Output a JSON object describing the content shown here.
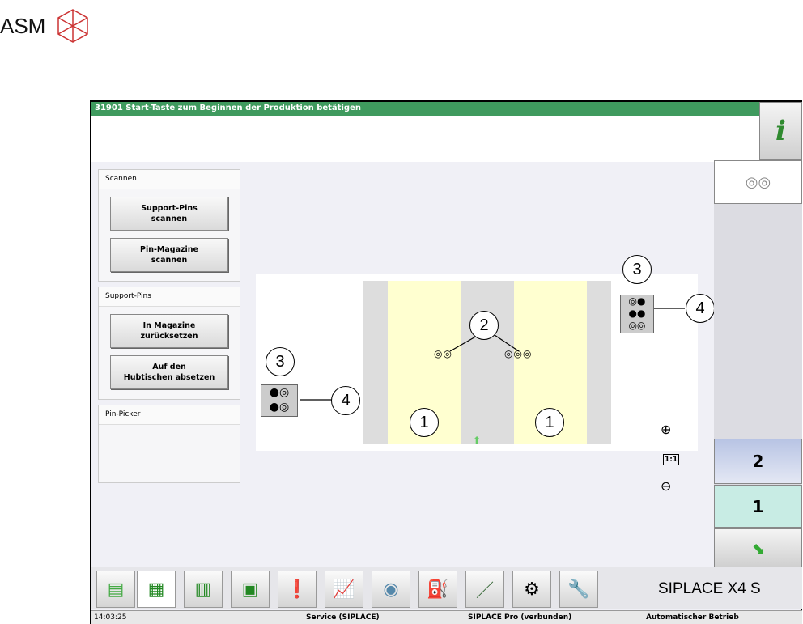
{
  "logo": {
    "text": "ASM"
  },
  "title": "31901 Start-Taste zum Beginnen der Produktion betätigen",
  "info_button": {
    "icon": "info-icon",
    "label": "i"
  },
  "groups": [
    {
      "header": "Scannen",
      "buttons": [
        "Support-Pins\nscannen",
        "Pin-Magazine\nscannen"
      ]
    },
    {
      "header": "Support-Pins",
      "buttons": [
        "In Magazine\nzurücksetzen",
        "Auf den\nHubtischen absetzen"
      ]
    },
    {
      "header": "Pin-Picker",
      "buttons": []
    }
  ],
  "callouts": {
    "lane": "1",
    "pins": "2",
    "magazine": "3",
    "pin_slot": "4"
  },
  "zoom": {
    "in": "+",
    "reset": "1:1",
    "out": "−"
  },
  "right": {
    "pins_tab_icon": "pins-icon",
    "conveyor_2": "2",
    "conveyor_1": "1",
    "exit_icon": "arrow-exit-icon"
  },
  "toolbar": {
    "items": [
      "boards-icon",
      "placement-grid-icon",
      "bar-chart-icon",
      "layout-icon",
      "messages-icon",
      "graph-icon",
      "camera-icon",
      "oil-can-icon",
      "nozzle-icon",
      "hand-gear-icon",
      "wrench-icon"
    ],
    "active": 1,
    "model": "SIPLACE X4 S"
  },
  "status": {
    "time": "14:03:25",
    "user": "Service (SIPLACE)",
    "connection": "SIPLACE Pro (verbunden)",
    "mode": "Automatischer Betrieb"
  },
  "colors": {
    "title_bar": "#3f9a5e",
    "lane": "#ffffd0",
    "active_conveyor": "#c8ece4"
  }
}
